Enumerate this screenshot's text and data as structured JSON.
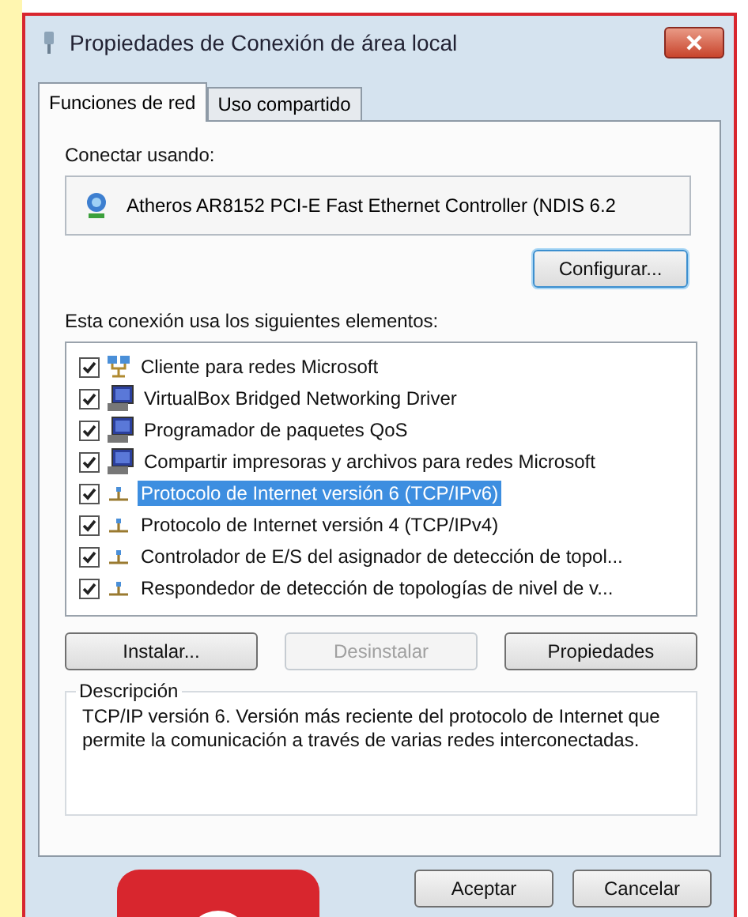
{
  "window": {
    "title": "Propiedades de Conexión de área local"
  },
  "tabs": [
    {
      "label": "Funciones de red",
      "selected": true
    },
    {
      "label": "Uso compartido",
      "selected": false
    }
  ],
  "connect_using": {
    "label": "Conectar usando:",
    "adapter": "Atheros AR8152 PCI-E Fast Ethernet Controller (NDIS 6.2"
  },
  "configure_button": "Configurar...",
  "components": {
    "label": "Esta conexión usa los siguientes elementos:",
    "items": [
      {
        "name": "Cliente para redes Microsoft",
        "checked": true,
        "selected": false,
        "kind": "client"
      },
      {
        "name": "VirtualBox Bridged Networking Driver",
        "checked": true,
        "selected": false,
        "kind": "service"
      },
      {
        "name": "Programador de paquetes QoS",
        "checked": true,
        "selected": false,
        "kind": "service"
      },
      {
        "name": "Compartir impresoras y archivos para redes Microsoft",
        "checked": true,
        "selected": false,
        "kind": "service"
      },
      {
        "name": "Protocolo de Internet versión 6 (TCP/IPv6)",
        "checked": true,
        "selected": true,
        "kind": "protocol"
      },
      {
        "name": "Protocolo de Internet versión 4 (TCP/IPv4)",
        "checked": true,
        "selected": false,
        "kind": "protocol"
      },
      {
        "name": "Controlador de E/S del asignador de detección de topol...",
        "checked": true,
        "selected": false,
        "kind": "protocol"
      },
      {
        "name": "Respondedor de detección de topologías de nivel de v...",
        "checked": true,
        "selected": false,
        "kind": "protocol"
      }
    ]
  },
  "item_buttons": [
    {
      "label": "Instalar...",
      "disabled": false
    },
    {
      "label": "Desinstalar",
      "disabled": true
    },
    {
      "label": "Propiedades",
      "disabled": false
    }
  ],
  "description": {
    "label": "Descripción",
    "text": "TCP/IP versión 6. Versión más reciente del protocolo de Internet que permite la comunicación a través de varias redes interconectadas."
  },
  "buttons": [
    "Aceptar",
    "Cancelar"
  ]
}
